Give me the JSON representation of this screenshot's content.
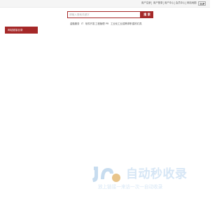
{
  "topbar": {
    "links": [
      "用户注册",
      "用户登录",
      "用户中心",
      "会员中心",
      "网站地图"
    ],
    "language": "简体"
  },
  "search": {
    "placeholder": "请输入搜索关键字",
    "button_label": "搜 索"
  },
  "hot_links": [
    "金融服务",
    "IT",
    "软件开发",
    "工程管理",
    "PR",
    "工业化工业",
    "招聘求职",
    "建材灯具"
  ],
  "category": {
    "label": "网站链接目录"
  },
  "watermark": {
    "title": "自动秒收录",
    "subtitle": "放上链接一来访一次一自动收录"
  },
  "colors": {
    "accent": "#a52828",
    "watermark": "#d6e6f5"
  }
}
